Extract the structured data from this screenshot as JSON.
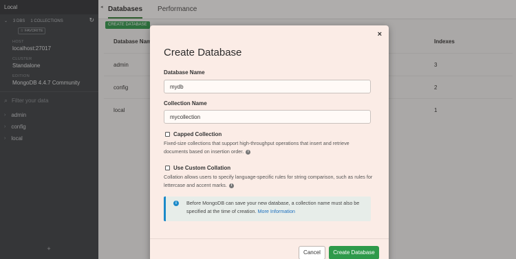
{
  "sidebar": {
    "title": "Local",
    "stats": {
      "dbs": "3 DBS",
      "collections": "1 COLLECTIONS"
    },
    "favorite_label": "☆ FAVORITE",
    "host": {
      "label": "HOST",
      "value": "localhost:27017"
    },
    "cluster": {
      "label": "CLUSTER",
      "value": "Standalone"
    },
    "edition": {
      "label": "EDITION",
      "value": "MongoDB 4.4.7 Community"
    },
    "filter_placeholder": "Filter your data",
    "databases": [
      "admin",
      "config",
      "local"
    ]
  },
  "tabs": [
    {
      "label": "Databases",
      "active": true
    },
    {
      "label": "Performance",
      "active": false
    }
  ],
  "toolbar": {
    "create_label": "CREATE DATABASE"
  },
  "table": {
    "headers": {
      "name": "Database Name",
      "indexes": "Indexes"
    },
    "rows": [
      {
        "name": "admin",
        "indexes": "3"
      },
      {
        "name": "config",
        "indexes": "2"
      },
      {
        "name": "local",
        "indexes": "1"
      }
    ]
  },
  "modal": {
    "title": "Create Database",
    "close_glyph": "×",
    "db_name_label": "Database Name",
    "db_name_value": "mydb",
    "collection_name_label": "Collection Name",
    "collection_name_value": "mycollection",
    "capped": {
      "label": "Capped Collection",
      "help": "Fixed-size collections that support high-throughput operations that insert and retrieve documents based on insertion order."
    },
    "collation": {
      "label": "Use Custom Collation",
      "help": "Collation allows users to specify language-specific rules for string comparison, such as rules for lettercase and accent marks."
    },
    "info": {
      "text": "Before MongoDB can save your new database, a collection name must also be specified at the time of creation.",
      "link": "More Information"
    },
    "cancel_label": "Cancel",
    "create_label": "Create Database"
  }
}
